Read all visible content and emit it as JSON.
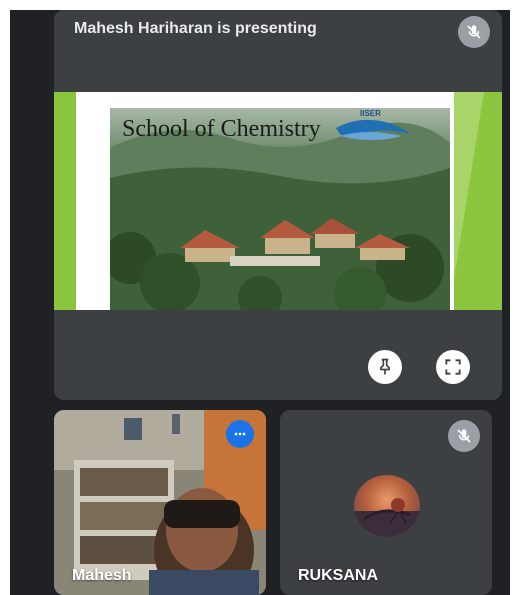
{
  "presenter": {
    "status_text": "Mahesh Hariharan is presenting",
    "mic_icon": "mic-off-icon"
  },
  "slide": {
    "title": "School of Chemistry",
    "logo_text": "IISER",
    "colors": {
      "accent": "#8cc63f"
    }
  },
  "controls": {
    "pin_icon": "pin-icon",
    "fullscreen_icon": "fullscreen-icon"
  },
  "participants": [
    {
      "name": "Mahesh",
      "more_icon": "more-options-icon"
    },
    {
      "name": "RUKSANA",
      "mic_icon": "mic-off-icon"
    }
  ],
  "colors": {
    "background": "#202124",
    "tile": "#3c4043",
    "more_button": "#1a73e8"
  }
}
